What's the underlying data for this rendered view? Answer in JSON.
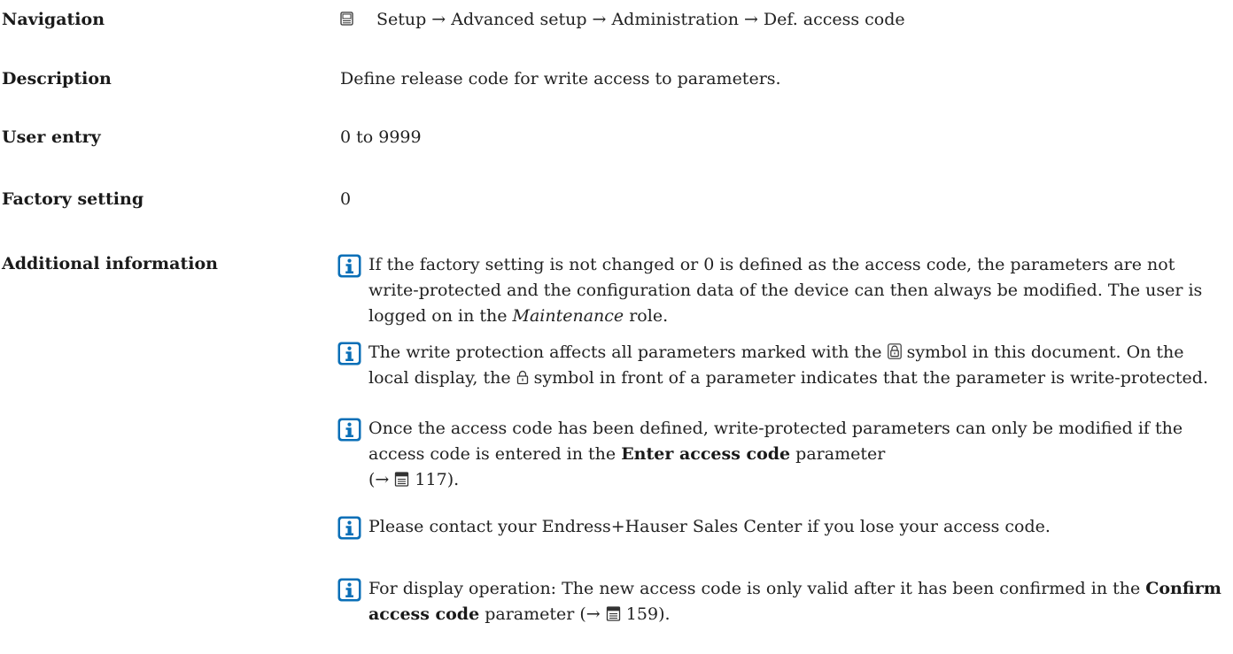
{
  "navigation": {
    "label": "Navigation",
    "icon": "operating-menu-icon",
    "path": [
      "Setup",
      "Advanced setup",
      "Administration",
      "Def. access code"
    ],
    "separator": "→"
  },
  "description": {
    "label": "Description",
    "text": "Define release code for write access to parameters."
  },
  "user_entry": {
    "label": "User entry",
    "text": "0 to 9999"
  },
  "factory_setting": {
    "label": "Factory setting",
    "text": "0"
  },
  "additional_information": {
    "label": "Additional information",
    "icon": "info-icon",
    "accent_color": "#0a6fb7",
    "notes": [
      {
        "p1": "If the factory setting is not changed or 0 is defined as the access code, the parameters are not write-protected and the configuration data of the device can then always be modified. The user is logged on in the ",
        "em": "Maintenance",
        "p2": " role."
      },
      {
        "p1": "The write protection affects all parameters marked with the ",
        "p2": " symbol in this document. On the local display, the ",
        "p3": " symbol in front of a parameter indicates that the parameter is write-protected."
      },
      {
        "p1": "Once the access code has been defined, write-protected parameters can only be modified if the access code is entered in the ",
        "strong": "Enter access code",
        "p2": " parameter",
        "ref_open": "(→ ",
        "ref_page": "117",
        "ref_close": ")."
      },
      {
        "text": "Please contact your Endress+Hauser Sales Center if you lose your access code."
      },
      {
        "p1": "For display operation: The new access code is only valid after it has been confirmed in the ",
        "strong": "Confirm access code",
        "p2": " parameter (→ ",
        "ref_page": "159",
        "ref_close": ")."
      }
    ]
  }
}
